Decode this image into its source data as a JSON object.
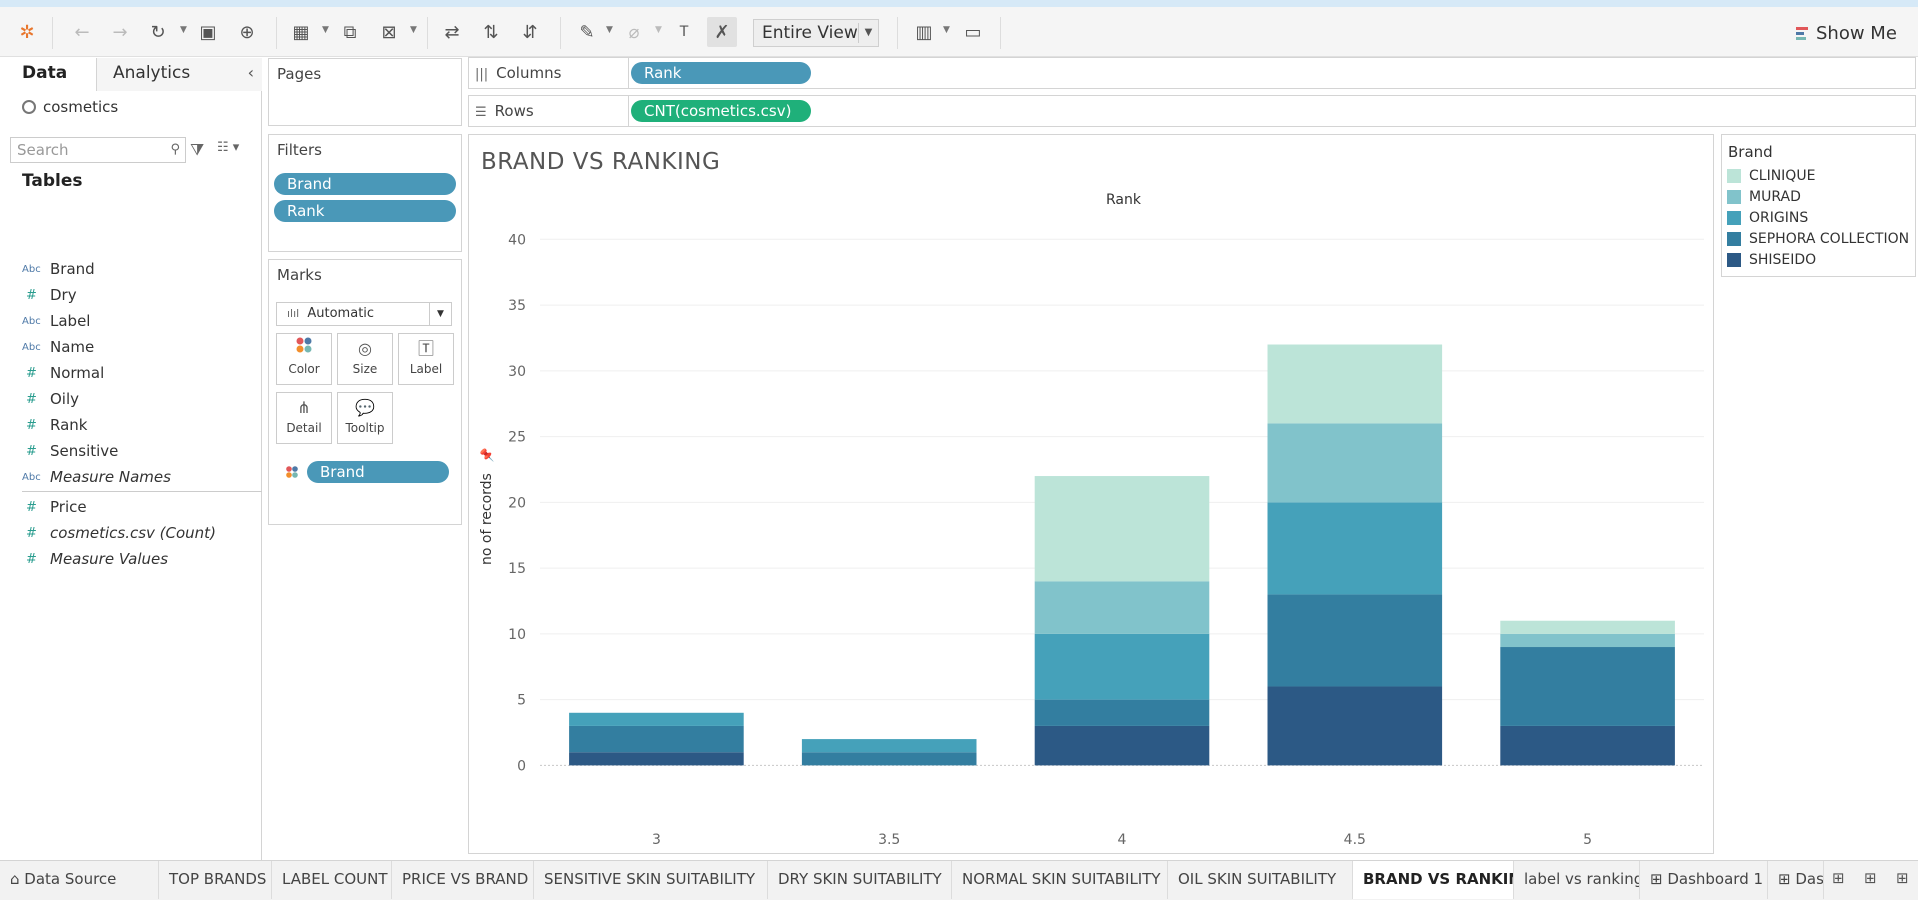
{
  "toolbar": {
    "view_mode": "Entire View",
    "show_me": "Show Me"
  },
  "data_pane": {
    "tab_data": "Data",
    "tab_analytics": "Analytics",
    "datasource": "cosmetics",
    "search_placeholder": "Search",
    "tables_heading": "Tables",
    "fields": [
      {
        "type": "Abc",
        "name": "Brand"
      },
      {
        "type": "#",
        "name": "Dry"
      },
      {
        "type": "Abc",
        "name": "Label"
      },
      {
        "type": "Abc",
        "name": "Name"
      },
      {
        "type": "#",
        "name": "Normal"
      },
      {
        "type": "#",
        "name": "Oily"
      },
      {
        "type": "#",
        "name": "Rank"
      },
      {
        "type": "#",
        "name": "Sensitive"
      },
      {
        "type": "Abc",
        "name": "Measure Names"
      },
      {
        "type": "#",
        "name": "Price"
      },
      {
        "type": "#",
        "name": "cosmetics.csv (Count)"
      },
      {
        "type": "#",
        "name": "Measure Values"
      }
    ]
  },
  "pages": {
    "title": "Pages"
  },
  "filters": {
    "title": "Filters",
    "pills": [
      "Brand",
      "Rank"
    ]
  },
  "marks": {
    "title": "Marks",
    "type": "Automatic",
    "buttons": [
      "Color",
      "Size",
      "Label",
      "Detail",
      "Tooltip"
    ],
    "color_pill": "Brand"
  },
  "shelves": {
    "columns_label": "Columns",
    "columns_pill": "Rank",
    "rows_label": "Rows",
    "rows_pill": "CNT(cosmetics.csv)"
  },
  "view": {
    "title": "BRAND VS RANKING"
  },
  "legend": {
    "title": "Brand",
    "items": [
      {
        "name": "CLINIQUE",
        "color": "#bce4d8"
      },
      {
        "name": "MURAD",
        "color": "#81c3cb"
      },
      {
        "name": "ORIGINS",
        "color": "#45a1ba"
      },
      {
        "name": "SEPHORA COLLECTION",
        "color": "#337ea0"
      },
      {
        "name": "SHISEIDO",
        "color": "#2c5985"
      }
    ]
  },
  "chart_data": {
    "type": "bar",
    "stacked": true,
    "title": "BRAND VS RANKING",
    "xlabel": "Rank",
    "ylabel": "no of records",
    "categories": [
      "3",
      "3.5",
      "4",
      "4.5",
      "5"
    ],
    "ylim": [
      -4,
      42
    ],
    "yticks": [
      0,
      5,
      10,
      15,
      20,
      25,
      30,
      35,
      40
    ],
    "grid": true,
    "legend_position": "right",
    "series": [
      {
        "name": "SHISEIDO",
        "color": "#2c5985",
        "values": [
          1,
          0,
          3,
          6,
          3
        ]
      },
      {
        "name": "SEPHORA COLLECTION",
        "color": "#337ea0",
        "values": [
          2,
          1,
          2,
          7,
          6
        ]
      },
      {
        "name": "ORIGINS",
        "color": "#45a1ba",
        "values": [
          1,
          1,
          5,
          7,
          0
        ]
      },
      {
        "name": "MURAD",
        "color": "#81c3cb",
        "values": [
          0,
          0,
          4,
          6,
          1
        ]
      },
      {
        "name": "CLINIQUE",
        "color": "#bce4d8",
        "values": [
          0,
          0,
          8,
          6,
          1
        ]
      }
    ]
  },
  "sheet_tabs": [
    "Data Source",
    "TOP BRANDS",
    "LABEL COUNT",
    "PRICE VS BRAND",
    "SENSITIVE SKIN SUITABILITY",
    "DRY SKIN SUITABILITY",
    "NORMAL SKIN SUITABILITY",
    "OIL SKIN SUITABILITY",
    "BRAND VS RANKING",
    "label vs ranking",
    "Dashboard 1",
    "Dash"
  ],
  "active_sheet": "BRAND VS RANKING"
}
